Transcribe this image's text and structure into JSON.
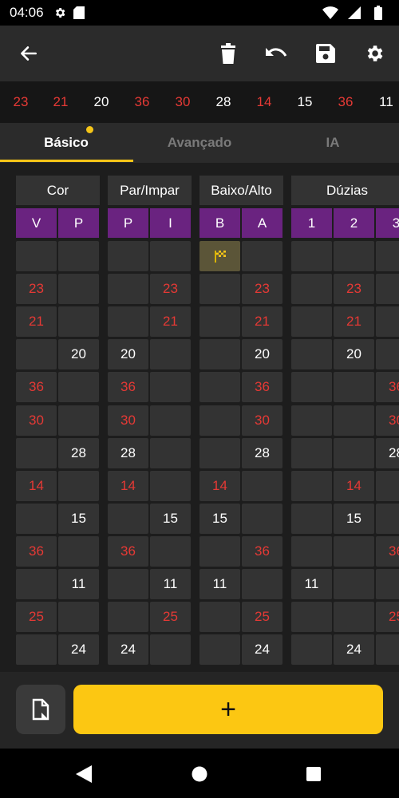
{
  "status": {
    "time": "04:06"
  },
  "toolbar": {
    "icons": [
      "back-arrow-icon",
      "trash-icon",
      "undo-icon",
      "save-icon",
      "settings-icon"
    ]
  },
  "history": [
    {
      "n": "23",
      "c": "red"
    },
    {
      "n": "21",
      "c": "red"
    },
    {
      "n": "20",
      "c": "white"
    },
    {
      "n": "36",
      "c": "red"
    },
    {
      "n": "30",
      "c": "red"
    },
    {
      "n": "28",
      "c": "white"
    },
    {
      "n": "14",
      "c": "red"
    },
    {
      "n": "15",
      "c": "white"
    },
    {
      "n": "36",
      "c": "red"
    },
    {
      "n": "11",
      "c": "white"
    }
  ],
  "tabs": [
    {
      "label": "Básico",
      "active": true
    },
    {
      "label": "Avançado",
      "active": false
    },
    {
      "label": "IA",
      "active": false
    }
  ],
  "groups": [
    {
      "title": "Cor",
      "subs": [
        "V",
        "P"
      ]
    },
    {
      "title": "Par/Impar",
      "subs": [
        "P",
        "I"
      ]
    },
    {
      "title": "Baixo/Alto",
      "subs": [
        "B",
        "A"
      ]
    },
    {
      "title": "Dúzias",
      "subs": [
        "1",
        "2",
        "3"
      ]
    }
  ],
  "rows": [
    {
      "n": "",
      "c": "white",
      "cor": null,
      "par": null,
      "ba": "flag",
      "duz": null
    },
    {
      "n": "23",
      "c": "red",
      "cor": 0,
      "par": 1,
      "ba": 1,
      "duz": 1
    },
    {
      "n": "21",
      "c": "red",
      "cor": 0,
      "par": 1,
      "ba": 1,
      "duz": 1
    },
    {
      "n": "20",
      "c": "white",
      "cor": 1,
      "par": 0,
      "ba": 1,
      "duz": 1
    },
    {
      "n": "36",
      "c": "red",
      "cor": 0,
      "par": 0,
      "ba": 1,
      "duz": 2
    },
    {
      "n": "30",
      "c": "red",
      "cor": 0,
      "par": 0,
      "ba": 1,
      "duz": 2
    },
    {
      "n": "28",
      "c": "white",
      "cor": 1,
      "par": 0,
      "ba": 1,
      "duz": 2
    },
    {
      "n": "14",
      "c": "red",
      "cor": 0,
      "par": 0,
      "ba": 0,
      "duz": 1
    },
    {
      "n": "15",
      "c": "white",
      "cor": 1,
      "par": 1,
      "ba": 0,
      "duz": 1
    },
    {
      "n": "36",
      "c": "red",
      "cor": 0,
      "par": 0,
      "ba": 1,
      "duz": 2
    },
    {
      "n": "11",
      "c": "white",
      "cor": 1,
      "par": 1,
      "ba": 0,
      "duz": 0
    },
    {
      "n": "25",
      "c": "red",
      "cor": 0,
      "par": 1,
      "ba": 1,
      "duz": 2
    },
    {
      "n": "24",
      "c": "white",
      "cor": 1,
      "par": 0,
      "ba": 1,
      "duz": 1
    }
  ],
  "bottom": {
    "add_label": "+"
  },
  "colors": {
    "accent": "#fcc712",
    "red": "#e53935",
    "header_purple": "#6a2380",
    "cell": "#333333"
  }
}
